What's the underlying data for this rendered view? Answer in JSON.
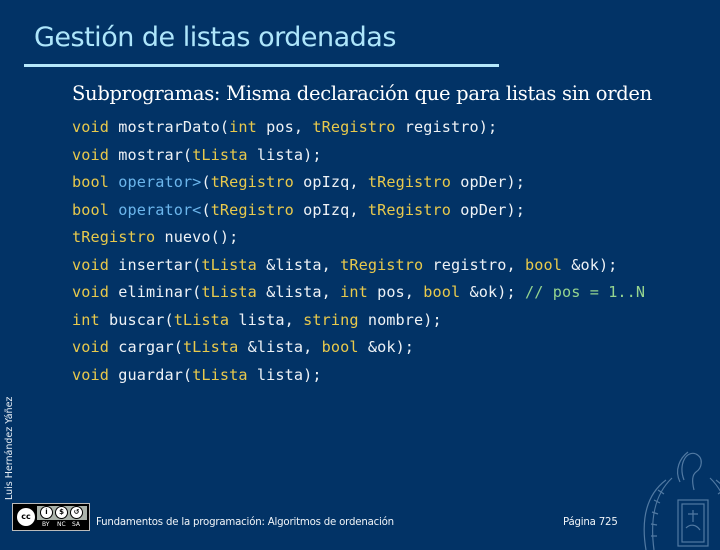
{
  "slide": {
    "title": "Gestión de listas ordenadas",
    "subtitle": "Subprogramas: Misma declaración que para listas sin orden",
    "code_lines": [
      [
        {
          "t": "void",
          "c": "kw"
        },
        {
          "t": " mostrarDato(",
          "c": ""
        },
        {
          "t": "int",
          "c": "kw"
        },
        {
          "t": " pos, ",
          "c": ""
        },
        {
          "t": "tRegistro",
          "c": "kw"
        },
        {
          "t": " registro);",
          "c": ""
        }
      ],
      [
        {
          "t": "void",
          "c": "kw"
        },
        {
          "t": " mostrar(",
          "c": ""
        },
        {
          "t": "tLista",
          "c": "kw"
        },
        {
          "t": " lista);",
          "c": ""
        }
      ],
      [
        {
          "t": "bool",
          "c": "kw"
        },
        {
          "t": " ",
          "c": ""
        },
        {
          "t": "operator>",
          "c": "fn-op"
        },
        {
          "t": "(",
          "c": ""
        },
        {
          "t": "tRegistro",
          "c": "kw"
        },
        {
          "t": " opIzq, ",
          "c": ""
        },
        {
          "t": "tRegistro",
          "c": "kw"
        },
        {
          "t": " opDer);",
          "c": ""
        }
      ],
      [
        {
          "t": "bool",
          "c": "kw"
        },
        {
          "t": " ",
          "c": ""
        },
        {
          "t": "operator<",
          "c": "fn-op"
        },
        {
          "t": "(",
          "c": ""
        },
        {
          "t": "tRegistro",
          "c": "kw"
        },
        {
          "t": " opIzq, ",
          "c": ""
        },
        {
          "t": "tRegistro",
          "c": "kw"
        },
        {
          "t": " opDer);",
          "c": ""
        }
      ],
      [
        {
          "t": "tRegistro",
          "c": "kw"
        },
        {
          "t": " nuevo();",
          "c": ""
        }
      ],
      [
        {
          "t": "void",
          "c": "kw"
        },
        {
          "t": " insertar(",
          "c": ""
        },
        {
          "t": "tLista",
          "c": "kw"
        },
        {
          "t": " &lista, ",
          "c": ""
        },
        {
          "t": "tRegistro",
          "c": "kw"
        },
        {
          "t": " registro, ",
          "c": ""
        },
        {
          "t": "bool",
          "c": "kw"
        },
        {
          "t": " &ok);",
          "c": ""
        }
      ],
      [
        {
          "t": "void",
          "c": "kw"
        },
        {
          "t": " eliminar(",
          "c": ""
        },
        {
          "t": "tLista",
          "c": "kw"
        },
        {
          "t": " &lista, ",
          "c": ""
        },
        {
          "t": "int",
          "c": "kw"
        },
        {
          "t": " pos, ",
          "c": ""
        },
        {
          "t": "bool",
          "c": "kw"
        },
        {
          "t": " &ok); ",
          "c": ""
        },
        {
          "t": "// pos = 1..N",
          "c": "cmt"
        }
      ],
      [
        {
          "t": "int",
          "c": "kw"
        },
        {
          "t": " buscar(",
          "c": ""
        },
        {
          "t": "tLista",
          "c": "kw"
        },
        {
          "t": " lista, ",
          "c": ""
        },
        {
          "t": "string",
          "c": "kw"
        },
        {
          "t": " nombre);",
          "c": ""
        }
      ],
      [
        {
          "t": "void",
          "c": "kw"
        },
        {
          "t": " cargar(",
          "c": ""
        },
        {
          "t": "tLista",
          "c": "kw"
        },
        {
          "t": " &lista, ",
          "c": ""
        },
        {
          "t": "bool",
          "c": "kw"
        },
        {
          "t": " &ok);",
          "c": ""
        }
      ],
      [
        {
          "t": "void",
          "c": "kw"
        },
        {
          "t": " guardar(",
          "c": ""
        },
        {
          "t": "tLista",
          "c": "kw"
        },
        {
          "t": " lista);",
          "c": ""
        }
      ]
    ]
  },
  "author": "Luis Hernández Yáñez",
  "license": {
    "icon": "creative-commons-by-nc-sa-icon",
    "main": "cc",
    "labels": [
      "BY",
      "NC",
      "SA"
    ]
  },
  "footer": {
    "course": "Fundamentos de la programación: Algoritmos de ordenación",
    "page": "Página 725"
  },
  "colors": {
    "background": "#023366",
    "title": "#aee6fb",
    "keyword": "#e8c94c",
    "operator": "#6cb6ec",
    "comment": "#95d48f",
    "text": "#eef2f6"
  }
}
